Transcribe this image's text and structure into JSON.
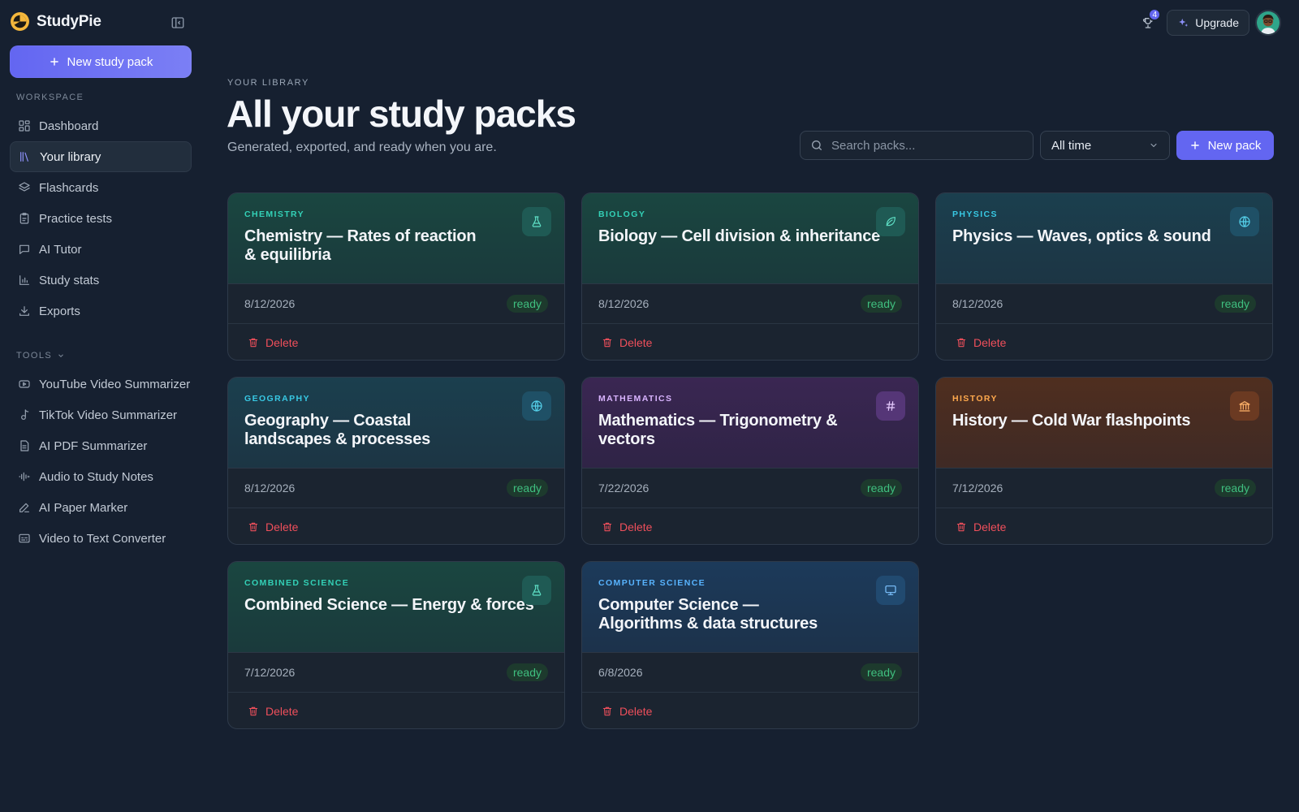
{
  "app": {
    "name": "StudyPie"
  },
  "topbar": {
    "notification_count": "4",
    "upgrade_label": "Upgrade"
  },
  "sidebar": {
    "new_button_label": "New study pack",
    "workspace_label": "WORKSPACE",
    "workspace_items": [
      {
        "label": "Dashboard",
        "icon": "dashboard-icon"
      },
      {
        "label": "Your library",
        "icon": "library-icon",
        "active": true
      },
      {
        "label": "Flashcards",
        "icon": "layers-icon"
      },
      {
        "label": "Practice tests",
        "icon": "clipboard-icon"
      },
      {
        "label": "AI Tutor",
        "icon": "chat-icon"
      },
      {
        "label": "Study stats",
        "icon": "bar-chart-icon"
      },
      {
        "label": "Exports",
        "icon": "download-icon"
      }
    ],
    "tools_label": "TOOLS",
    "tools_items": [
      {
        "label": "YouTube Video Summarizer",
        "icon": "youtube-icon"
      },
      {
        "label": "TikTok Video Summarizer",
        "icon": "music-note-icon"
      },
      {
        "label": "AI PDF Summarizer",
        "icon": "file-icon"
      },
      {
        "label": "Audio to Study Notes",
        "icon": "audio-wave-icon"
      },
      {
        "label": "AI Paper Marker",
        "icon": "pen-icon"
      },
      {
        "label": "Video to Text Converter",
        "icon": "captions-icon"
      }
    ]
  },
  "header": {
    "eyebrow": "YOUR LIBRARY",
    "title": "All your study packs",
    "subtitle": "Generated, exported, and ready when you are.",
    "search_placeholder": "Search packs...",
    "time_filter": "All time",
    "new_pack_label": "New pack"
  },
  "cards": [
    {
      "subject": "CHEMISTRY",
      "title": "Chemistry — Rates of reaction & equilibria",
      "date": "8/12/2026",
      "status": "ready",
      "delete_label": "Delete",
      "icon": "flask-icon",
      "theme": "teal"
    },
    {
      "subject": "BIOLOGY",
      "title": "Biology — Cell division & inheritance",
      "date": "8/12/2026",
      "status": "ready",
      "delete_label": "Delete",
      "icon": "leaf-icon",
      "theme": "teal"
    },
    {
      "subject": "PHYSICS",
      "title": "Physics — Waves, optics & sound",
      "date": "8/12/2026",
      "status": "ready",
      "delete_label": "Delete",
      "icon": "globe-icon",
      "theme": "blue"
    },
    {
      "subject": "GEOGRAPHY",
      "title": "Geography — Coastal landscapes & processes",
      "date": "8/12/2026",
      "status": "ready",
      "delete_label": "Delete",
      "icon": "globe-icon",
      "theme": "blue"
    },
    {
      "subject": "MATHEMATICS",
      "title": "Mathematics — Trigonometry & vectors",
      "date": "7/22/2026",
      "status": "ready",
      "delete_label": "Delete",
      "icon": "hash-icon",
      "theme": "purple"
    },
    {
      "subject": "HISTORY",
      "title": "History — Cold War flashpoints",
      "date": "7/12/2026",
      "status": "ready",
      "delete_label": "Delete",
      "icon": "landmark-icon",
      "theme": "orange"
    },
    {
      "subject": "COMBINED SCIENCE",
      "title": "Combined Science — Energy & forces",
      "date": "7/12/2026",
      "status": "ready",
      "delete_label": "Delete",
      "icon": "flask-icon",
      "theme": "teal"
    },
    {
      "subject": "COMPUTER SCIENCE",
      "title": "Computer Science — Algorithms & data structures",
      "date": "6/8/2026",
      "status": "ready",
      "delete_label": "Delete",
      "icon": "monitor-icon",
      "theme": "navy"
    }
  ],
  "colors": {
    "accent": "#6366f1",
    "background": "#162030",
    "status_ready": "#3fbf7f",
    "delete": "#ef4f5b"
  }
}
